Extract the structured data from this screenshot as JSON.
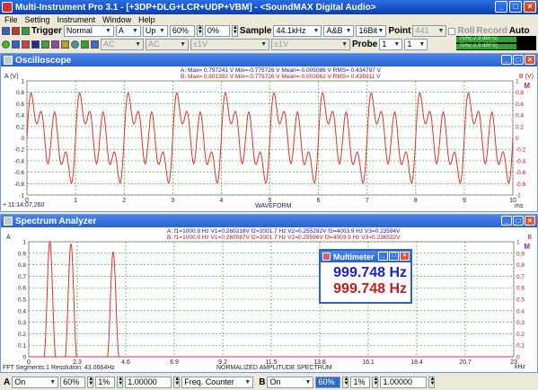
{
  "window": {
    "title": "Multi-Instrument Pro 3.1  -  [+3DP+DLG+LCR+UDP+VBM]  -  <SoundMAX Digital Audio>",
    "minimize": "_",
    "maximize": "□",
    "close": "×"
  },
  "menu": [
    "File",
    "Setting",
    "Instrument",
    "Window",
    "Help"
  ],
  "toolbar1": {
    "trigger_label": "Trigger",
    "trigger_mode": "Normal",
    "trigger_channel": "A",
    "trigger_edge": "Up",
    "trigger_level": "60%",
    "trigger_delay": "0%",
    "sample_label": "Sample",
    "sample_rate": "44.1kHz",
    "channels": "A&B",
    "bits": "16Bit",
    "point_label": "Point",
    "point_value": "441",
    "roll_label": "Roll",
    "record_label": "Record",
    "auto_label": "Auto",
    "level_a": "75%(-2.9 dBFS)",
    "level_b": "75%(-2.9 dBFS)"
  },
  "toolbar2": {
    "ac1": "AC",
    "ac2": "AC",
    "v1": "±1V",
    "v2": "±1V",
    "probe_label": "Probe",
    "probe_a": "1",
    "probe_b": "1"
  },
  "oscilloscope": {
    "title": "Oscilloscope",
    "ylabel": "A (V)",
    "ylabel_right": "B (V)",
    "stats_a": "A: Max= 0.797241 V   Min=-0.775726 V    Mean=-0.005086 V   RMS= 0.434797 V",
    "stats_b": "B: Max= 0.801392 V   Min=-0.775726 V    Mean=-0.003062 V   RMS= 0.435911 V",
    "timestamp": "+ 11:14:07.260",
    "xlabel": "WAVEFORM",
    "xunit": "ms",
    "xticks": [
      "0",
      "1",
      "2",
      "3",
      "4",
      "5",
      "6",
      "7",
      "8",
      "9",
      "10"
    ],
    "yticks": [
      "1",
      "0.8",
      "0.6",
      "0.4",
      "0.2",
      "0",
      "-0.2",
      "-0.4",
      "-0.6",
      "-0.8",
      "-1"
    ],
    "yticks_right": [
      "1",
      "0.8",
      "0.6",
      "0.4",
      "0.2",
      "0",
      "-0.2",
      "-0.4",
      "-0.6",
      "-0.8",
      "-1"
    ],
    "marker": "M"
  },
  "spectrum": {
    "title": "Spectrum Analyzer",
    "ylabel": "A",
    "ylabel_right": "B",
    "stats_a": "A: f1=1000.9 Hz  V1=0.260218V  f2=2001.7 Hz  V2=0.255292V  f3=4003.9 Hz  V3=0.23594V",
    "stats_b": "B: f1=1000.9 Hz  V1=0.260087V  f2=2001.7 Hz  V2=0.25596V  f3=4003.9 Hz  V3=0.236532V",
    "footer_left": "FFT Segments:1    Resolution: 43.0664Hz",
    "xlabel": "NORMALIZED AMPLITUDE SPECTRUM",
    "xunit": "kHz",
    "xticks": [
      "0",
      "2.3",
      "4.6",
      "6.9",
      "9.2",
      "11.5",
      "13.8",
      "16.1",
      "18.4",
      "20.7",
      "23"
    ],
    "yticks": [
      "1",
      "0.9",
      "0.8",
      "0.7",
      "0.6",
      "0.5",
      "0.4",
      "0.3",
      "0.2",
      "0.1",
      "0"
    ],
    "yticks_right": [
      "1",
      "0.9",
      "0.8",
      "0.7",
      "0.6",
      "0.5",
      "0.4",
      "0.3",
      "0.2",
      "0.1",
      "0"
    ],
    "marker": "M"
  },
  "multimeter": {
    "title": "Multimeter",
    "value_a": "999.748 Hz",
    "value_b": "999.748 Hz"
  },
  "bottombar": {
    "a_label": "A",
    "a_mode": "On",
    "a_pct1": "60%",
    "a_pct2": "1%",
    "a_value": "1.00000",
    "function": "Freq. Counter",
    "b_label": "B",
    "b_mode": "On",
    "b_pct1": "60%",
    "b_pct2": "1%",
    "b_value": "1.00000"
  },
  "colors": {
    "channel_a": "#1010c0",
    "channel_b": "#c01010",
    "grid": "#22aa22",
    "waveform": "#e03030"
  },
  "chart_data": [
    {
      "type": "line",
      "title": "Oscilloscope",
      "xlabel": "WAVEFORM",
      "ylabel": "A (V)",
      "xlim": [
        0,
        10
      ],
      "ylim": [
        -1,
        1
      ],
      "series": [
        {
          "name": "A",
          "function": "0.26*sin(2π·1·t)+0.255*sin(2π·2·t)+0.236*sin(2π·4·t) (normalized, t in ms)"
        }
      ]
    },
    {
      "type": "line",
      "title": "Spectrum Analyzer",
      "xlabel": "NORMALIZED AMPLITUDE SPECTRUM",
      "ylabel": "A",
      "xlim": [
        0,
        23
      ],
      "ylim": [
        0,
        1
      ],
      "x": [
        1.0009,
        2.0017,
        4.0039
      ],
      "series": [
        {
          "name": "A",
          "values": [
            1.0,
            0.98,
            0.91
          ]
        }
      ]
    }
  ]
}
